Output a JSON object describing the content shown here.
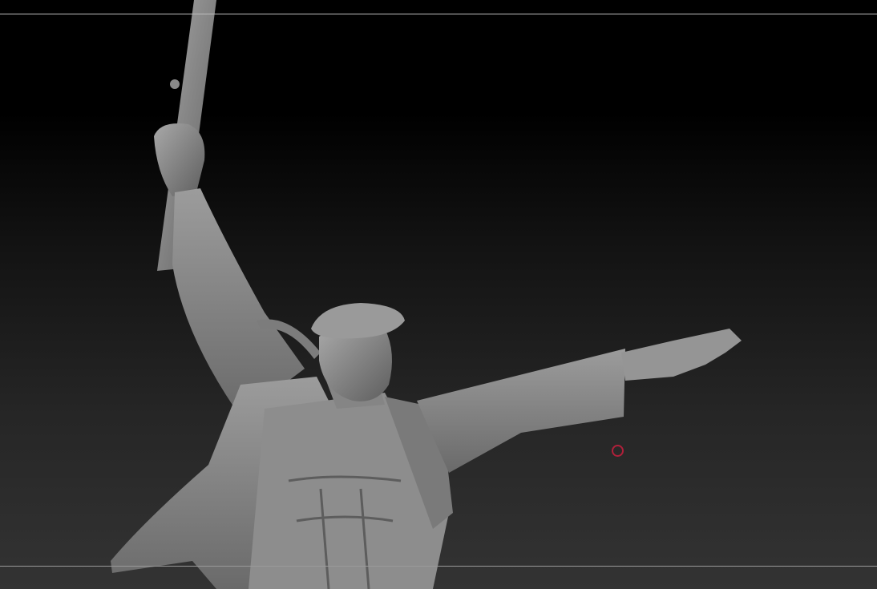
{
  "viewport": {
    "background_top": "#000000",
    "background_bottom": "#333333",
    "model_color": "#8a8a8a",
    "cursor_color": "#b0203a",
    "cursor_icon": "brush-circle-icon"
  }
}
